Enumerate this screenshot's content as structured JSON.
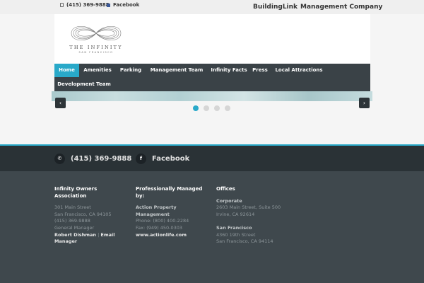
{
  "topbar": {
    "phone": "(415) 369-9888",
    "facebook": "Facebook",
    "buildinglink": "BuildingLink",
    "management_company": "Management Company"
  },
  "logo": {
    "title": "THE INFINITY",
    "subtitle": "SAN FRANCISCO"
  },
  "nav": {
    "items": [
      "Home",
      "Amenities",
      "Parking",
      "Management Team",
      "Infinity Facts",
      "Press",
      "Local Attractions",
      "Development Team"
    ]
  },
  "slider": {
    "prev_icon": "‹",
    "next_icon": "›",
    "active_index": 0,
    "dot_count": 4
  },
  "footer_top": {
    "phone": "(415) 369-9888",
    "facebook": "Facebook",
    "facebook_icon": "f"
  },
  "footer": {
    "association": {
      "heading": "Infinity Owners Association",
      "address1": "301 Main Street",
      "address2": "San Francisco, CA 94105",
      "phone": "(415) 369-9888",
      "role": "General Manager",
      "manager": "Robert Dishman",
      "separator": "|",
      "email_label": "Email",
      "email_label2": "Manager"
    },
    "managed": {
      "heading": "Professionally Managed by:",
      "company": "Action Property Management",
      "phone": "Phone: (800) 400-2284",
      "fax": "Fax: (949) 450-0303",
      "website": "www.actionlife.com"
    },
    "offices": {
      "heading": "Offices",
      "corporate_label": "Corporate",
      "corporate_addr1": "2603 Main Street, Suite 500",
      "corporate_addr2": "Irvine, CA 92614",
      "sf_label": "San Francisco",
      "sf_addr1": "4360 19th Street",
      "sf_addr2": "San Francisco, CA 94114"
    }
  },
  "colors": {
    "accent": "#29a9c9",
    "nav_bg": "#3a4247",
    "footer_bg": "#3f484d"
  }
}
